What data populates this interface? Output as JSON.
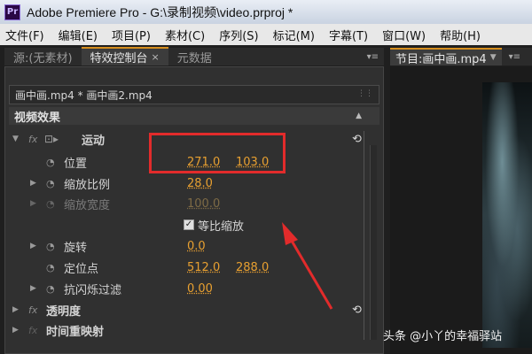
{
  "window": {
    "app_icon": "Pr",
    "title": "Adobe Premiere Pro - G:\\录制视频\\video.prproj *"
  },
  "menu": [
    "文件(F)",
    "编辑(E)",
    "项目(P)",
    "素材(C)",
    "序列(S)",
    "标记(M)",
    "字幕(T)",
    "窗口(W)",
    "帮助(H)"
  ],
  "left_tabs": {
    "source": "源:(无素材)",
    "effect_controls": "特效控制台",
    "close": "×",
    "metadata": "元数据",
    "menu_icon": "▾≡"
  },
  "effect_panel": {
    "source_label": "画中画.mp4 * 画中画2.mp4",
    "section_title": "视频效果",
    "motion": {
      "label": "运动",
      "position": {
        "label": "位置",
        "x": "271.0",
        "y": "103.0"
      },
      "scale": {
        "label": "缩放比例",
        "value": "28.0"
      },
      "scale_width": {
        "label": "缩放宽度",
        "value": "100.0"
      },
      "uniform_scale": {
        "label": "等比缩放",
        "checked": true
      },
      "rotation": {
        "label": "旋转",
        "value": "0.0"
      },
      "anchor": {
        "label": "定位点",
        "x": "512.0",
        "y": "288.0"
      },
      "anti_flicker": {
        "label": "抗闪烁过滤",
        "value": "0.00"
      }
    },
    "opacity": {
      "label": "透明度"
    },
    "time_remap": {
      "label": "时间重映射"
    }
  },
  "right_panel": {
    "tab_label": "节目:画中画.mp4",
    "menu_icon": "▾≡"
  },
  "watermark": "头条 @小丫的幸福驿站",
  "colors": {
    "highlight": "#e22b2b",
    "value_orange": "#e8a030",
    "tab_accent": "#d68e1e"
  }
}
